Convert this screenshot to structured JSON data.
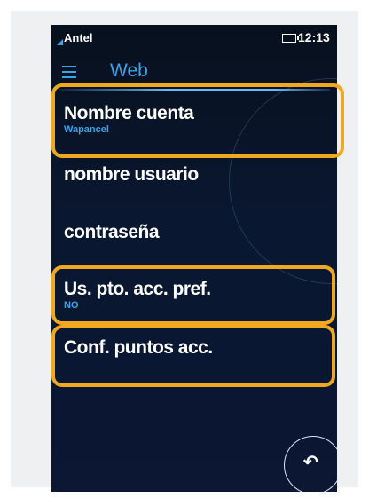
{
  "status": {
    "carrier": "Antel",
    "time": "12:13"
  },
  "header": {
    "title": "Web"
  },
  "items": [
    {
      "label": "Nombre cuenta",
      "value": "Wapancel"
    },
    {
      "label": "nombre usuario",
      "value": ""
    },
    {
      "label": "contraseña",
      "value": ""
    },
    {
      "label": "Us. pto. acc. pref.",
      "value": "NO"
    },
    {
      "label": "Conf. puntos acc.",
      "value": ""
    }
  ],
  "icons": {
    "menu": "menu-icon",
    "back": "back-arrow-icon",
    "signal": "signal-icon",
    "battery": "battery-icon"
  },
  "colors": {
    "accent": "#3ba3e8",
    "highlight": "#f0a820",
    "background": "#0a1730"
  }
}
